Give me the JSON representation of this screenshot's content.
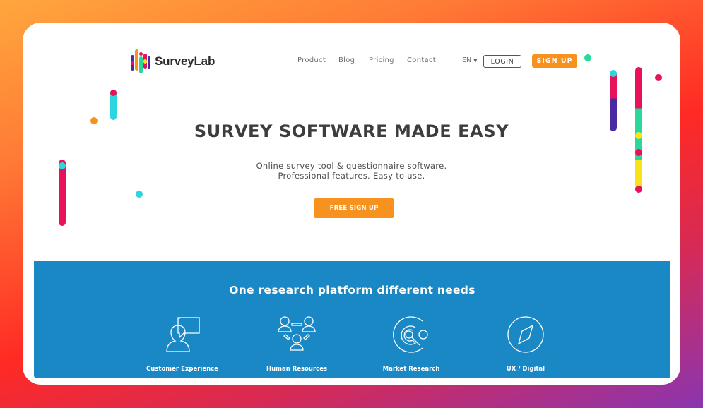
{
  "header": {
    "brand": "SurveyLab",
    "nav": [
      "Product",
      "Blog",
      "Pricing",
      "Contact"
    ],
    "language": "EN",
    "login_label": "LOGIN",
    "signup_label": "SIGN UP"
  },
  "hero": {
    "title": "SURVEY SOFTWARE MADE EASY",
    "subtitle_line1": "Online survey tool & questionnaire software.",
    "subtitle_line2": "Professional features. Easy to use.",
    "cta_label": "FREE SIGN UP"
  },
  "features": {
    "title": "One research platform different needs",
    "items": [
      {
        "label": "Customer Experience",
        "icon": "customer-chat-icon"
      },
      {
        "label": "Human Resources",
        "icon": "people-network-icon"
      },
      {
        "label": "Market Research",
        "icon": "target-search-icon"
      },
      {
        "label": "UX / Digital",
        "icon": "compass-icon"
      }
    ]
  },
  "colors": {
    "accent_orange": "#f7921e",
    "section_blue": "#1a88c4",
    "deco_pink": "#e8115b",
    "deco_cyan": "#2dd5df",
    "deco_purple": "#4a2aa0",
    "deco_green": "#2ad99a",
    "deco_yellow": "#fbe11a"
  }
}
